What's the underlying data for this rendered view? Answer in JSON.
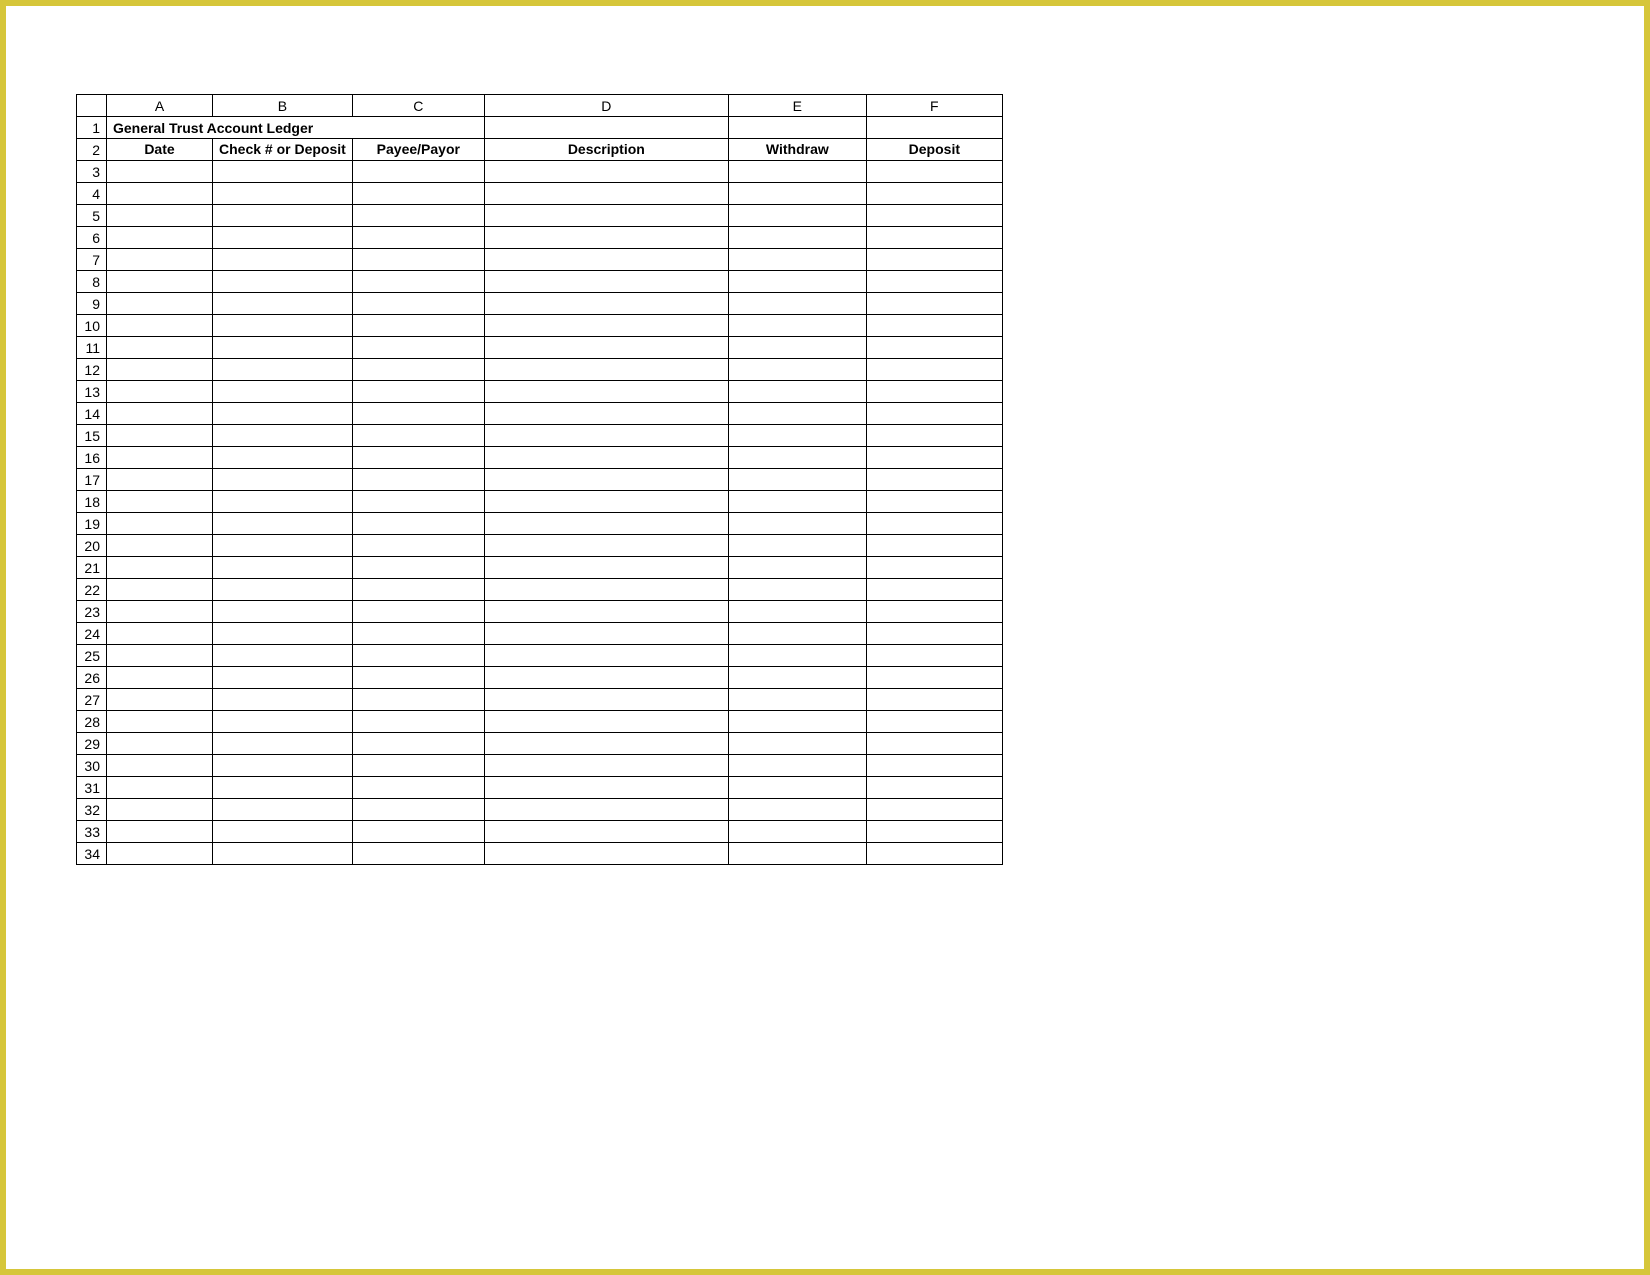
{
  "columnLetters": [
    "A",
    "B",
    "C",
    "D",
    "E",
    "F"
  ],
  "titleRow": {
    "number": "1",
    "title": "General Trust Account Ledger"
  },
  "headerRow": {
    "number": "2",
    "cells": [
      "Date",
      "Check # or Deposit",
      "Payee/Payor",
      "Description",
      "Withdraw",
      "Deposit"
    ],
    "bgColor": "#d6f0d6"
  },
  "dataRowNumbers": [
    "3",
    "4",
    "5",
    "6",
    "7",
    "8",
    "9",
    "10",
    "11",
    "12",
    "13",
    "14",
    "15",
    "16",
    "17",
    "18",
    "19",
    "20",
    "21",
    "22",
    "23",
    "24",
    "25",
    "26",
    "27",
    "28",
    "29",
    "30",
    "31",
    "32",
    "33",
    "34"
  ],
  "colors": {
    "frameBorder": "#d6c63a",
    "gridLine": "#000000",
    "headerFill": "#d6f0d6"
  }
}
